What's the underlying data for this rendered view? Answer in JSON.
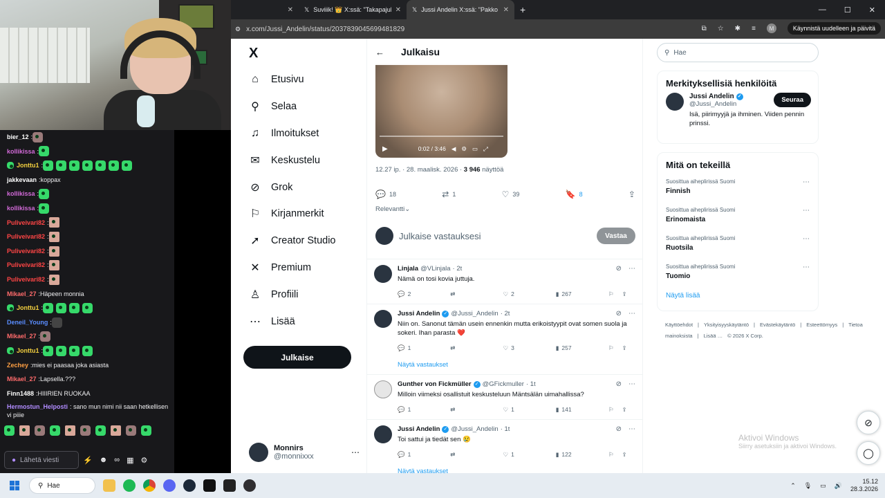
{
  "browser": {
    "tabs": [
      {
        "title": "Suviiik! 👑 X:ssä: \"Takapajula! P",
        "active": false
      },
      {
        "title": "Jussi Andelin X:ssä: \"Pakko sano",
        "active": true
      }
    ],
    "new_tab": "+",
    "url": "x.com/Jussi_Andelin/status/2037839045699481829",
    "profile_initial": "M",
    "restart_label": "Käynnistä uudelleen ja päivitä"
  },
  "chat": {
    "messages": [
      {
        "user": "bier_12",
        "color": "#ffffff",
        "text": "",
        "emotes": [
          "img"
        ]
      },
      {
        "user": "kollikissa",
        "color": "#d26ad8",
        "text": "",
        "emotes": [
          "green"
        ]
      },
      {
        "user": "Jonttu1",
        "color": "#f4d03f",
        "text": "",
        "emotes": [
          "green",
          "green",
          "green",
          "green",
          "green",
          "green",
          "green"
        ],
        "badge": true
      },
      {
        "user": "jakkevaan",
        "color": "#ffffff",
        "text": "koppax",
        "emotes": []
      },
      {
        "user": "kollikissa",
        "color": "#d26ad8",
        "text": "",
        "emotes": [
          "green"
        ]
      },
      {
        "user": "kollikissa",
        "color": "#d26ad8",
        "text": "",
        "emotes": [
          "green"
        ]
      },
      {
        "user": "Puliveivari82",
        "color": "#ff4545",
        "text": "",
        "emotes": [
          "hand"
        ]
      },
      {
        "user": "Puliveivari82",
        "color": "#ff4545",
        "text": "",
        "emotes": [
          "hand"
        ]
      },
      {
        "user": "Puliveivari82",
        "color": "#ff4545",
        "text": "",
        "emotes": [
          "hand"
        ]
      },
      {
        "user": "Puliveivari82",
        "color": "#ff4545",
        "text": "",
        "emotes": [
          "hand"
        ]
      },
      {
        "user": "Puliveivari82",
        "color": "#ff4545",
        "text": "",
        "emotes": [
          "hand"
        ]
      },
      {
        "user": "Mikael_27",
        "color": "#ff6b6b",
        "text": "Häpeen monnia",
        "emotes": []
      },
      {
        "user": "Jonttu1",
        "color": "#f4d03f",
        "text": "",
        "emotes": [
          "green",
          "green",
          "green",
          "green"
        ],
        "badge": true
      },
      {
        "user": "Deneil_Young",
        "color": "#5a8dff",
        "text": "",
        "emotes": [
          "mute"
        ]
      },
      {
        "user": "Mikael_27",
        "color": "#ff6b6b",
        "text": "",
        "emotes": [
          "img"
        ]
      },
      {
        "user": "Jonttu1",
        "color": "#f4d03f",
        "text": "",
        "emotes": [
          "green",
          "green",
          "green",
          "green"
        ],
        "badge": true
      },
      {
        "user": "Zechey",
        "color": "#ff9f43",
        "text": "mies ei paasaa joka asiasta",
        "emotes": []
      },
      {
        "user": "Mikael_27",
        "color": "#ff6b6b",
        "text": "Lapsella.???",
        "emotes": []
      },
      {
        "user": "Finn1488",
        "color": "#ffffff",
        "text": "HIIIRIEN RUOKAA",
        "emotes": []
      }
    ],
    "wrapped_message": {
      "user": "Hermostun_Helposti",
      "color": "#b18cff",
      "text": "sano mun nimi nii saan hetkellisen vi piiie"
    },
    "input_placeholder": "Lähetä viesti"
  },
  "nav": {
    "logo": "X",
    "items": [
      {
        "label": "Etusivu",
        "icon": "home-icon",
        "glyph": "⌂"
      },
      {
        "label": "Selaa",
        "icon": "search-icon",
        "glyph": "⚲"
      },
      {
        "label": "Ilmoitukset",
        "icon": "bell-icon",
        "glyph": "♫"
      },
      {
        "label": "Keskustelu",
        "icon": "mail-icon",
        "glyph": "✉"
      },
      {
        "label": "Grok",
        "icon": "grok-icon",
        "glyph": "⊘"
      },
      {
        "label": "Kirjanmerkit",
        "icon": "bookmark-icon",
        "glyph": "⚐"
      },
      {
        "label": "Creator Studio",
        "icon": "rocket-icon",
        "glyph": "➚"
      },
      {
        "label": "Premium",
        "icon": "x-premium-icon",
        "glyph": "✕"
      },
      {
        "label": "Profiili",
        "icon": "profile-icon",
        "glyph": "♙"
      },
      {
        "label": "Lisää",
        "icon": "more-circle-icon",
        "glyph": "⋯"
      }
    ],
    "post_button": "Julkaise",
    "account": {
      "name": "Monnirs",
      "handle": "@monnixxx",
      "more": "⋯"
    }
  },
  "post": {
    "header_title": "Julkaisu",
    "video_time": "0:02 / 3:46",
    "timestamp": "12.27 ip. · 28. maalisk. 2026 · ",
    "views_count": "3 946",
    "views_label": "näyttöä",
    "replies": "18",
    "reposts": "1",
    "likes": "39",
    "bookmarks": "8",
    "sort_label": "Relevantti",
    "reply_placeholder": "Julkaise vastauksesi",
    "reply_button": "Vastaa"
  },
  "replies": [
    {
      "name": "Linjala",
      "handle": "@VLinjala",
      "time": "· 2t",
      "verified": false,
      "text": "Nämä on tosi kovia juttuja.",
      "replies": "2",
      "reposts": "",
      "likes": "2",
      "views": "267",
      "show_more": ""
    },
    {
      "name": "Jussi Andelin",
      "handle": "@Jussi_Andelin",
      "time": "· 2t",
      "verified": true,
      "text": "Niin on. Sanonut tämän usein ennenkin mutta erikoistyypit ovat somen suola ja sokeri. Ihan parasta ❤️",
      "replies": "1",
      "reposts": "",
      "likes": "3",
      "views": "257",
      "show_more": "Näytä vastaukset"
    },
    {
      "name": "Gunther von Fickmüller",
      "handle": "@GFickmuller",
      "time": "· 1t",
      "verified": true,
      "text": "Milloin viimeksi osallistuit keskusteluun Mäntsälän uimahallissa?",
      "replies": "1",
      "reposts": "",
      "likes": "1",
      "views": "141",
      "show_more": ""
    },
    {
      "name": "Jussi Andelin",
      "handle": "@Jussi_Andelin",
      "time": "· 1t",
      "verified": true,
      "text": "Toi sattui ja tiedät sen 😢",
      "replies": "1",
      "reposts": "",
      "likes": "1",
      "views": "122",
      "show_more": "Näytä vastaukset"
    }
  ],
  "sidebar": {
    "search_placeholder": "Hae",
    "who_title": "Merkityksellisiä henkilöitä",
    "who": {
      "name": "Jussi Andelin",
      "handle": "@Jussi_Andelin",
      "bio": "Isä, piirimyyjä ja ihminen. Viiden pennin prinssi.",
      "follow": "Seuraa"
    },
    "trends_title": "Mitä on tekeillä",
    "trends": [
      {
        "context": "Suosittua aiheplirissä Suomi",
        "title": "Finnish"
      },
      {
        "context": "Suosittua aiheplirissä Suomi",
        "title": "Erinomaista"
      },
      {
        "context": "Suosittua aiheplirissä Suomi",
        "title": "Ruotsila"
      },
      {
        "context": "Suosittua aiheplirissä Suomi",
        "title": "Tuomio"
      }
    ],
    "show_more": "Näytä lisää",
    "footer": [
      "Käyttöehdot",
      "|",
      "Yksityisyyskäytäntö",
      "|",
      "Evästekäytäntö",
      "|",
      "Esteettömyys",
      "|",
      "Tietoa mainoksista",
      "|",
      "Lisää …",
      "© 2026 X Corp."
    ]
  },
  "windows": {
    "activate_title": "Aktivoi Windows",
    "activate_sub": "Siirry asetuksiin ja aktivoi Windows.",
    "search": "Hae",
    "time": "15.12",
    "date": "28.3.2026"
  }
}
